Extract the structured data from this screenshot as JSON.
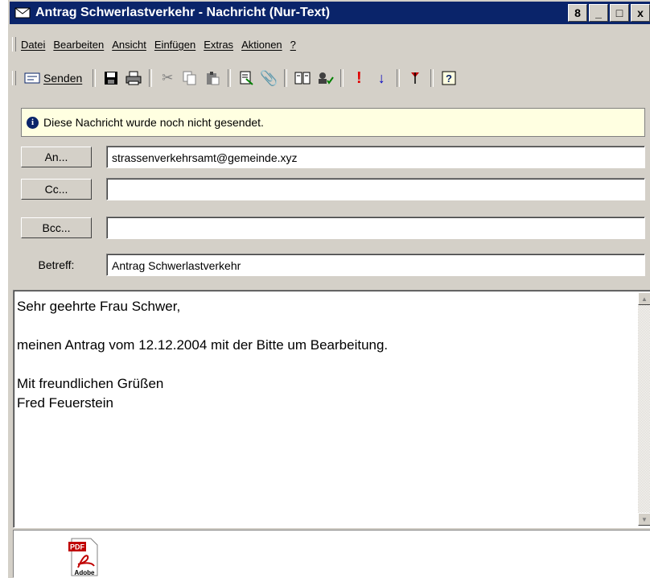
{
  "window": {
    "title": "Antrag Schwerlastverkehr - Nachricht (Nur-Text)",
    "buttons": {
      "restore": "8",
      "minimize": "_",
      "maximize": "□",
      "close": "x"
    }
  },
  "menubar": {
    "items": [
      "Datei",
      "Bearbeiten",
      "Ansicht",
      "Einfügen",
      "Extras",
      "Aktionen",
      "?"
    ]
  },
  "toolbar": {
    "send_label": "Senden",
    "icons": [
      "save-icon",
      "print-icon",
      "cut-icon",
      "copy-icon",
      "paste-icon",
      "insert-file-icon",
      "attach-icon",
      "address-book-icon",
      "check-names-icon",
      "high-importance-icon",
      "low-importance-icon",
      "flag-icon",
      "help-icon"
    ]
  },
  "info": {
    "text": "Diese Nachricht wurde noch nicht gesendet."
  },
  "header": {
    "to_label": "An...",
    "to_value": "strassenverkehrsamt@gemeinde.xyz",
    "cc_label": "Cc...",
    "cc_value": "",
    "bcc_label": "Bcc...",
    "bcc_value": "",
    "subject_label": "Betreff:",
    "subject_value": "Antrag Schwerlastverkehr"
  },
  "body": {
    "text": "Sehr geehrte Frau Schwer,\n\nmeinen Antrag vom 12.12.2004 mit der Bitte um Bearbeitung.\n\nMit freundlichen Grüßen\nFred Feuerstein"
  },
  "attachment": {
    "icon": "pdf-icon",
    "badge": "PDF",
    "brand": "Adobe"
  },
  "colors": {
    "titlebar": "#0a246a",
    "infobar": "#ffffe1",
    "chrome": "#d4d0c8"
  }
}
